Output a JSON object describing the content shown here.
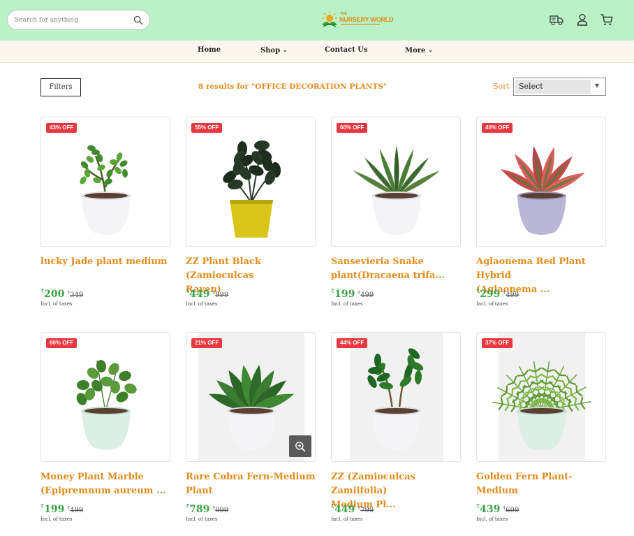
{
  "header": {
    "search_placeholder": "Search for anything",
    "logo_small": "THE",
    "logo_main": "NURSERY WORLD",
    "icons": [
      "delivery-truck-icon",
      "user-icon",
      "cart-icon"
    ]
  },
  "nav": {
    "items": [
      {
        "label": "Home",
        "has_dropdown": false
      },
      {
        "label": "Shop",
        "has_dropdown": true
      },
      {
        "label": "Contact Us",
        "has_dropdown": false
      },
      {
        "label": "More",
        "has_dropdown": true
      }
    ]
  },
  "toolbar": {
    "filters_label": "Filters",
    "results_text": "8 results for \"OFFICE DECORATION PLANTS\"",
    "sort_label": "Sort",
    "sort_value": "Select"
  },
  "colors": {
    "header_bg": "#b9f2c6",
    "nav_bg": "#fcf7ee",
    "accent_orange": "#e38b1c",
    "price_green": "#3aa346",
    "badge_red": "#e8373f"
  },
  "products": [
    {
      "badge": "43% OFF",
      "title_lines": [
        "lucky Jade plant medium",
        ""
      ],
      "currency": "₹",
      "price": "200",
      "old_price": "349",
      "tax": "Incl. of taxes",
      "plant": "jade",
      "pot": "white"
    },
    {
      "badge": "55% OFF",
      "title_lines": [
        "ZZ Plant Black (Zamioculcas",
        "Raven)"
      ],
      "currency": "₹",
      "price": "449",
      "old_price": "999",
      "tax": "Incl. of taxes",
      "plant": "zz-black",
      "pot": "yellow"
    },
    {
      "badge": "60% OFF",
      "title_lines": [
        "Sansevieria Snake",
        "plant(Dracaena trifa..."
      ],
      "currency": "₹",
      "price": "199",
      "old_price": "499",
      "tax": "Incl. of taxes",
      "plant": "snake",
      "pot": "white"
    },
    {
      "badge": "40% OFF",
      "title_lines": [
        "Aglaonema Red Plant Hybrid",
        "(Aglaonema ..."
      ],
      "currency": "₹",
      "price": "299",
      "old_price": "499",
      "tax": "Incl. of taxes",
      "plant": "aglaonema",
      "pot": "lilac"
    },
    {
      "badge": "60% OFF",
      "title_lines": [
        "Money Plant Marble",
        "(Epipremnum aureum ..."
      ],
      "currency": "₹",
      "price": "199",
      "old_price": "499",
      "tax": "Incl. of taxes",
      "plant": "money",
      "pot": "mint"
    },
    {
      "badge": "21% OFF",
      "title_lines": [
        "Rare Cobra Fern-Medium",
        "Plant"
      ],
      "currency": "₹",
      "price": "789",
      "old_price": "999",
      "tax": "Incl. of taxes",
      "plant": "cobra-fern",
      "pot": "white",
      "hovered": true
    },
    {
      "badge": "44% OFF",
      "title_lines": [
        "ZZ (Zamioculcas Zamiifolia)",
        "Medium Pl..."
      ],
      "currency": "₹",
      "price": "449",
      "old_price": "799",
      "tax": "Incl. of taxes",
      "plant": "zz-green",
      "pot": "white"
    },
    {
      "badge": "37% OFF",
      "title_lines": [
        "Golden Fern Plant-Medium",
        ""
      ],
      "currency": "₹",
      "price": "439",
      "old_price": "699",
      "tax": "Incl. of taxes",
      "plant": "golden-fern",
      "pot": "mint"
    }
  ]
}
